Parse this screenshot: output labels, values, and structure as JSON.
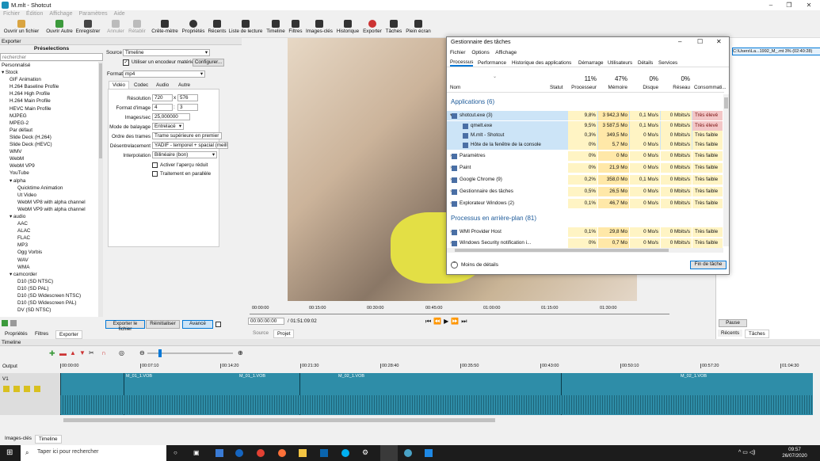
{
  "window": {
    "title": "M.mlt - Shotcut",
    "controls": [
      "–",
      "❐",
      "✕"
    ]
  },
  "menu": [
    "Fichier",
    "Édition",
    "Affichage",
    "Paramètres",
    "Aide"
  ],
  "toolbar": [
    "Ouvrir un fichier",
    "Ouvrir Autre",
    "Enregistrer",
    "Annuler",
    "Rétablir",
    "Crête-mètre",
    "Propriétés",
    "Récents",
    "Liste de lecture",
    "Timeline",
    "Filtres",
    "Images-clés",
    "Historique",
    "Exporter",
    "Tâches",
    "Plein écran"
  ],
  "export": {
    "panel_title": "Exporter",
    "presets_title": "Préselections",
    "search_placeholder": "rechercher",
    "presets": [
      "Personnalisé",
      "▾ Stock",
      "GIF Animation",
      "H.264 Baseline Profile",
      "H.264 High Profile",
      "H.264 Main Profile",
      "HEVC Main Profile",
      "MJPEG",
      "MPEG-2",
      "Par défaut",
      "Slide Deck (H.264)",
      "Slide Deck (HEVC)",
      "WMV",
      "WebM",
      "WebM VP9",
      "YouTube",
      "▾ alpha",
      "Quicktime Animation",
      "Ut Video",
      "WebM VP8 with alpha channel",
      "WebM VP9 with alpha channel",
      "▾ audio",
      "AAC",
      "ALAC",
      "FLAC",
      "MP3",
      "Ogg Vorbis",
      "WAV",
      "WMA",
      "▾ camcorder",
      "D10 (SD NTSC)",
      "D10 (SD PAL)",
      "D10 (SD Widescreen NTSC)",
      "D10 (SD Widescreen PAL)",
      "DV (SD NTSC)"
    ],
    "preset_indent": [
      0,
      0,
      1,
      1,
      1,
      1,
      1,
      1,
      1,
      1,
      1,
      1,
      1,
      1,
      1,
      1,
      1,
      2,
      2,
      2,
      2,
      1,
      2,
      2,
      2,
      2,
      2,
      2,
      2,
      1,
      2,
      2,
      2,
      2,
      2
    ],
    "source_label": "Source",
    "source_value": "Timeline",
    "hw_encoder": "Utiliser un encodeur matériel",
    "configure": "Configurer...",
    "format_label": "Format",
    "format_value": "mp4",
    "tabs": [
      "Vidéo",
      "Codec",
      "Audio",
      "Autre"
    ],
    "resolution_label": "Résolution",
    "res_w": "720",
    "res_h": "576",
    "x": "x",
    "aspect_label": "Format d'image",
    "asp_w": "4",
    "asp_h": "3",
    "colon": ":",
    "fps_label": "Images/sec",
    "fps": "25,000000",
    "scan_label": "Mode de balayage",
    "scan": "Entrelacé",
    "field_label": "Ordre des trames",
    "field": "Trame supérieure en premier",
    "deint_label": "Désentrelacement",
    "deint": "YADIF - temporel + spacial (meill",
    "interp_label": "Interpolation",
    "interp": "Bilinéaire (bon)",
    "preview_scale": "Activer l'aperçu réduit",
    "parallel": "Traitement en parallèle",
    "export_file": "Exporter le fichier",
    "reset": "Réinitialiser",
    "advanced": "Avancé",
    "bottom_tabs": [
      "Propriétés",
      "Filtres",
      "Exporter"
    ]
  },
  "player": {
    "ruler": [
      "00:00:00",
      "00:15:00",
      "00:30:00",
      "00:45:00",
      "01:00:00",
      "01:15:00",
      "01:30:00"
    ],
    "timecode": "00:00:00:00",
    "duration": "/ 01:51:09:02",
    "tabs": [
      "Source",
      "Projet"
    ]
  },
  "right_panel": {
    "path": "C:\\Users\\La...1992_M_.mt 3% (02:40:28)",
    "pause": "Pause",
    "tabs": [
      "Récents",
      "Tâches"
    ]
  },
  "taskmgr": {
    "title": "Gestionnaire des tâches",
    "menu": [
      "Fichier",
      "Options",
      "Affichage"
    ],
    "tabs": [
      "Processus",
      "Performance",
      "Historique des applications",
      "Démarrage",
      "Utilisateurs",
      "Détails",
      "Services"
    ],
    "cols": [
      "Nom",
      "Statut",
      "Processeur",
      "Mémoire",
      "Disque",
      "Réseau",
      "Consommati..."
    ],
    "totals": [
      "11%",
      "47%",
      "0%",
      "0%"
    ],
    "apps_header": "Applications (6)",
    "bg_header": "Processus en arrière-plan (81)",
    "rows": [
      {
        "name": "shotcut.exe (3)",
        "cpu": "9,8%",
        "mem": "3 942,3 Mo",
        "disk": "0,1 Mo/s",
        "net": "0 Mbits/s",
        "use": "Très élevé",
        "indent": 1,
        "expand": "▾"
      },
      {
        "name": "qmelt.exe",
        "cpu": "9,5%",
        "mem": "3 587,5 Mo",
        "disk": "0,1 Mo/s",
        "net": "0 Mbits/s",
        "use": "Très élevé",
        "indent": 2,
        "expand": ""
      },
      {
        "name": "M.mlt - Shotcut",
        "cpu": "0,3%",
        "mem": "349,5 Mo",
        "disk": "0 Mo/s",
        "net": "0 Mbits/s",
        "use": "Très faible",
        "indent": 2,
        "expand": ""
      },
      {
        "name": "Hôte de la fenêtre de la console",
        "cpu": "0%",
        "mem": "5,7 Mo",
        "disk": "0 Mo/s",
        "net": "0 Mbits/s",
        "use": "Très faible",
        "indent": 2,
        "expand": ""
      },
      {
        "name": "Paramètres",
        "cpu": "0%",
        "mem": "0 Mo",
        "disk": "0 Mo/s",
        "net": "0 Mbits/s",
        "use": "Très faible",
        "indent": 1,
        "expand": "›"
      },
      {
        "name": "Paint",
        "cpu": "0%",
        "mem": "21,9 Mo",
        "disk": "0 Mo/s",
        "net": "0 Mbits/s",
        "use": "Très faible",
        "indent": 1,
        "expand": "›"
      },
      {
        "name": "Google Chrome (9)",
        "cpu": "0,2%",
        "mem": "358,0 Mo",
        "disk": "0,1 Mo/s",
        "net": "0 Mbits/s",
        "use": "Très faible",
        "indent": 1,
        "expand": "›"
      },
      {
        "name": "Gestionnaire des tâches",
        "cpu": "0,5%",
        "mem": "26,5 Mo",
        "disk": "0 Mo/s",
        "net": "0 Mbits/s",
        "use": "Très faible",
        "indent": 1,
        "expand": "›"
      },
      {
        "name": "Explorateur Windows (2)",
        "cpu": "0,1%",
        "mem": "46,7 Mo",
        "disk": "0 Mo/s",
        "net": "0 Mbits/s",
        "use": "Très faible",
        "indent": 1,
        "expand": "›"
      },
      {
        "name": "WMI Provider Host",
        "cpu": "0,1%",
        "mem": "29,8 Mo",
        "disk": "0 Mo/s",
        "net": "0 Mbits/s",
        "use": "Très faible",
        "indent": 1,
        "expand": "›"
      },
      {
        "name": "Windows Security notification i...",
        "cpu": "0%",
        "mem": "0,7 Mo",
        "disk": "0 Mo/s",
        "net": "0 Mbits/s",
        "use": "Très faible",
        "indent": 1,
        "expand": "›"
      }
    ],
    "less": "Moins de détails",
    "end_task": "Fin de tâche"
  },
  "timeline": {
    "title": "Timeline",
    "output": "Output",
    "track": "V1",
    "ticks": [
      "00:00:00",
      "00:07:10",
      "00:14:20",
      "00:21:30",
      "00:28:40",
      "00:35:50",
      "00:43:00",
      "00:50:10",
      "00:57:20",
      "01:04:30"
    ],
    "clip_labels": [
      "M_01_1.VOB",
      "M_01_1.VOB",
      "M_02_1.VOB",
      "M_02_1.VOB"
    ],
    "bottom_tabs": [
      "Images-clés",
      "Timeline"
    ]
  },
  "taskbar": {
    "search": "Taper ici pour rechercher",
    "time": "09:57",
    "date": "26/07/2020"
  }
}
